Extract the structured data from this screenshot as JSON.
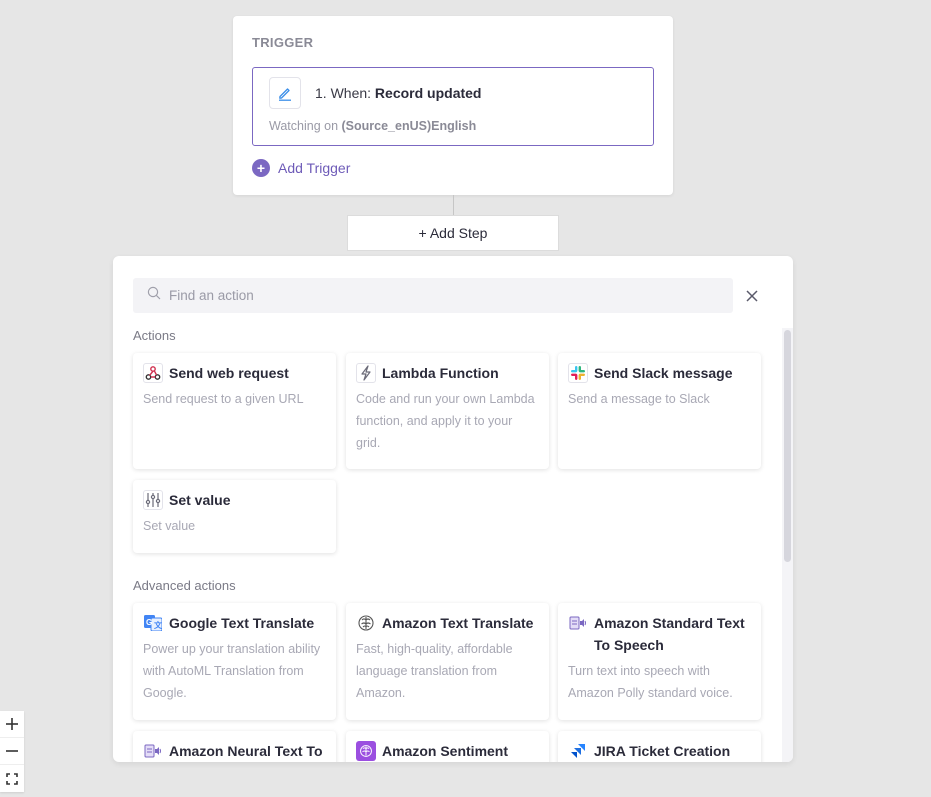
{
  "trigger": {
    "heading": "TRIGGER",
    "step_prefix": "1. When: ",
    "step_event": "Record updated",
    "watch_prefix": "Watching on ",
    "watch_target": "(Source_enUS)English",
    "add_trigger_label": "Add Trigger",
    "icon": "pencil-icon"
  },
  "add_step_label": "+ Add Step",
  "panel": {
    "search_placeholder": "Find an action",
    "search_value": "",
    "sections": [
      {
        "label": "Actions",
        "items": [
          {
            "title": "Send web request",
            "desc": "Send request to a given URL",
            "icon": "webhook-icon"
          },
          {
            "title": "Lambda Function",
            "desc": "Code and run your own Lambda function, and apply it to your grid.",
            "icon": "lightning-icon"
          },
          {
            "title": "Send Slack message",
            "desc": "Send a message to Slack",
            "icon": "slack-icon"
          },
          {
            "title": "Set value",
            "desc": "Set value",
            "icon": "sliders-icon"
          }
        ]
      },
      {
        "label": "Advanced actions",
        "items": [
          {
            "title": "Google Text Translate",
            "desc": "Power up your translation ability with AutoML Translation from Google.",
            "icon": "google-translate-icon"
          },
          {
            "title": "Amazon Text Translate",
            "desc": "Fast, high-quality, affordable language translation from Amazon.",
            "icon": "brain-icon"
          },
          {
            "title": "Amazon Standard Text To Speech",
            "desc": "Turn text into speech with Amazon Polly standard voice.",
            "icon": "text-to-speech-icon"
          },
          {
            "title": "Amazon Neural Text To Speech",
            "desc": "",
            "icon": "text-to-speech-icon"
          },
          {
            "title": "Amazon Sentiment",
            "desc": "",
            "icon": "sentiment-brain-icon"
          },
          {
            "title": "JIRA Ticket Creation",
            "desc": "",
            "icon": "jira-icon"
          }
        ]
      }
    ]
  },
  "colors": {
    "accent": "#7b68c2",
    "background": "#e6e6e6",
    "card": "#ffffff",
    "muted_text": "#a8a8b4"
  }
}
